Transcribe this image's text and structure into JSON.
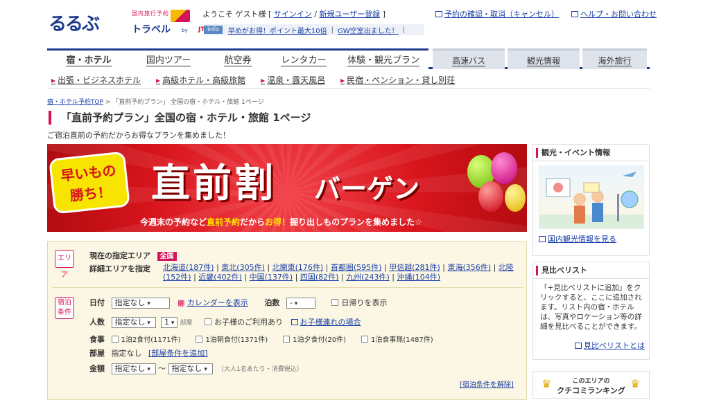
{
  "header": {
    "logo_main": "るるぶ",
    "logo_small": "国内旅行予約",
    "logo_travel": "トラベル",
    "logo_by": "by",
    "logo_jtb": "JTB",
    "welcome_prefix": "ようこそ ゲスト様 [",
    "signin": "サインイン",
    "slash": "/",
    "register": "新規ユーザー登録",
    "welcome_suffix": "]",
    "info_badge": "info",
    "info_1": "早めがお得！ポイント最大10倍",
    "info_sep": "|",
    "info_2": "GW空室出ました！",
    "link_confirm": "予約の確認・取消（キャンセル）",
    "link_help": "ヘルプ・お問い合わせ"
  },
  "nav": {
    "tabs": [
      "宿・ホテル",
      "国内ツアー",
      "航空券",
      "レンタカー",
      "体験・観光プラン"
    ],
    "secondary": [
      "高速バス",
      "観光情報",
      "海外旅行"
    ],
    "sub": [
      "出張・ビジネスホテル",
      "高級ホテル・高級旅館",
      "温泉・露天風呂",
      "民宿・ペンション・貸し別荘"
    ]
  },
  "breadcrumb": {
    "home": "宿・ホテル予約TOP",
    "sep": ">",
    "current": "「直前予約プラン」 全国の宿・ホテル・旅館 1ページ"
  },
  "page": {
    "title": "「直前予約プラン」全国の宿・ホテル・旅館 1ページ",
    "lead": "ご宿泊直前の予約だからお得なプランを集めました！"
  },
  "banner": {
    "early_1": "早いもの",
    "early_2": "勝ち！",
    "big": "直前割",
    "bargain": "バーゲン",
    "sub_1": "今週末の予約など",
    "sub_hl1": "直前予約",
    "sub_2": "だから",
    "sub_hl2": "お得！",
    "sub_3": "掘り出しものプランを集めました☆"
  },
  "search": {
    "area_tag": "エリア",
    "current_area_label": "現在の指定エリア",
    "current_area": "全国",
    "detail_label": "詳細エリアを指定",
    "areas": [
      "北海道(187件)",
      "東北(305件)",
      "北関東(176件)",
      "首都圏(595件)",
      "甲信越(281件)",
      "東海(356件)",
      "北陸(152件)",
      "近畿(402件)",
      "中国(137件)",
      "四国(82件)",
      "九州(243件)",
      "沖縄(104件)"
    ],
    "cond_tag_1": "宿泊",
    "cond_tag_2": "条件",
    "date_label": "日付",
    "date_value": "指定なし",
    "calendar_link": "カレンダーを表示",
    "nights_label": "泊数",
    "nights_value": "-",
    "dayuse": "日帰りを表示",
    "people_label": "人数",
    "people_value": "指定なし",
    "rooms_value": "1",
    "rooms_unit": "部屋",
    "children": "お子様のご利用あり",
    "children_link": "お子様連れの場合",
    "meal_label": "食事",
    "meals": [
      "1泊2食付(1171件)",
      "1泊朝食付(1371件)",
      "1泊夕食付(20件)",
      "1泊食事無(1487件)"
    ],
    "room_label": "部屋",
    "room_value": "指定なし",
    "room_add": "[部屋条件を追加]",
    "price_label": "金額",
    "price_from": "指定なし",
    "price_tilde": "～",
    "price_to": "指定なし",
    "price_note": "（大人1名あたり・消費税込）",
    "clear": "[宿泊条件を解除]"
  },
  "right": {
    "kanko_title": "観光・イベント情報",
    "kanko_link": "国内観光情報を見る",
    "hikaku_title": "見比べリスト",
    "hikaku_text": "「+見比べリストに追加」をクリックすると、ここに追加されます。リスト内の宿・ホテルは、写真やロケーション等の詳細を見比べることができます。",
    "hikaku_link": "見比べリストとは",
    "ranking_1": "このエリアの",
    "ranking_2": "クチコミランキング"
  },
  "colors": {
    "brand_blue": "#1d3a8f",
    "accent_pink": "#d4145a",
    "banner_red": "#d8141c"
  }
}
